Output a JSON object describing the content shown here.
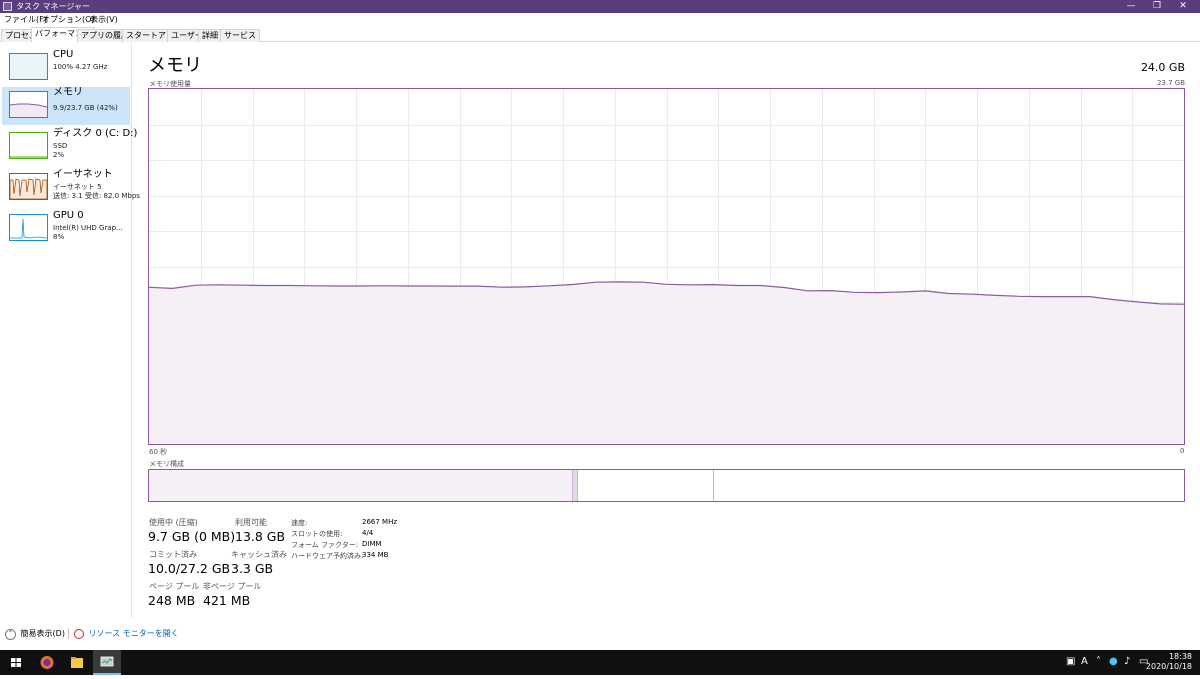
{
  "window": {
    "title": "タスク マネージャー",
    "minimize": "—",
    "restore": "❐",
    "close": "✕"
  },
  "menu": [
    "ファイル(F)",
    "オプション(O)",
    "表示(V)"
  ],
  "tabs": [
    "プロセス",
    "パフォーマンス",
    "アプリの履歴",
    "スタートアップ",
    "ユーザー",
    "詳細",
    "サービス"
  ],
  "active_tab": "パフォーマンス",
  "sidebar": {
    "items": [
      {
        "name": "CPU",
        "sub1": "100%  4.27 GHz",
        "sub2": "",
        "color": "#1b8fd4"
      },
      {
        "name": "メモリ",
        "sub1": "9.9/23.7 GB (42%)",
        "sub2": "",
        "color": "#8b5a9e"
      },
      {
        "name": "ディスク 0 (C: D:)",
        "sub1": "SSD",
        "sub2": "2%",
        "color": "#4da60c"
      },
      {
        "name": "イーサネット",
        "sub1": "イーサネット 5",
        "sub2": "送信: 3.1  受信: 82.0 Mbps",
        "color": "#a74f01"
      },
      {
        "name": "GPU 0",
        "sub1": "Intel(R) UHD Grap...",
        "sub2": "8%",
        "color": "#1b8fd4"
      }
    ]
  },
  "main": {
    "title": "メモリ",
    "total": "24.0 GB",
    "usage_label": "メモリ使用量",
    "max_label": "23.7 GB",
    "time_left": "60 秒",
    "time_right": "0",
    "composition_label": "メモリ構成"
  },
  "usage_history": {
    "max_gb": 23.7,
    "values_gb": [
      10.46,
      10.39,
      10.6,
      10.63,
      10.6,
      10.58,
      10.58,
      10.56,
      10.55,
      10.55,
      10.56,
      10.55,
      10.55,
      10.54,
      10.54,
      10.47,
      10.49,
      10.56,
      10.65,
      10.8,
      10.82,
      10.8,
      10.66,
      10.63,
      10.64,
      10.58,
      10.58,
      10.45,
      10.23,
      10.24,
      10.13,
      10.11,
      10.15,
      10.22,
      10.05,
      10.0,
      9.92,
      9.86,
      9.84,
      9.84,
      9.84,
      9.64,
      9.49,
      9.35,
      9.33
    ]
  },
  "composition": {
    "in_use_fraction": 0.41,
    "modified_fraction": 0.005,
    "standby_fraction": 0.131
  },
  "stats": {
    "in_use_label": "使用中 (圧縮)",
    "in_use": "9.7 GB (0 MB)",
    "available_label": "利用可能",
    "available": "13.8 GB",
    "committed_label": "コミット済み",
    "committed": "10.0/27.2 GB",
    "cached_label": "キャッシュ済み",
    "cached": "3.3 GB",
    "paged_label": "ページ プール",
    "paged": "248 MB",
    "nonpaged_label": "非ページ プール",
    "nonpaged": "421 MB"
  },
  "details": [
    {
      "label": "速度:",
      "value": "2667 MHz"
    },
    {
      "label": "スロットの使用:",
      "value": "4/4"
    },
    {
      "label": "フォーム ファクター:",
      "value": "DIMM"
    },
    {
      "label": "ハードウェア予約済み:",
      "value": "334 MB"
    }
  ],
  "bottom": {
    "summary": "簡易表示(D)",
    "resmon": "リソース モニターを開く"
  },
  "taskbar": {
    "time": "18:38",
    "date": "2020/10/18",
    "ime": "A"
  },
  "colors": {
    "titlebar": "#5a3d7d",
    "memory": "#8b5a9e",
    "memory_fill": "#f4f0f6",
    "link": "#0063b1"
  }
}
